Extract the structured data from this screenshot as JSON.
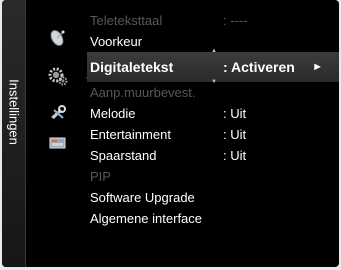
{
  "sidebar": {
    "title": "Instellingen"
  },
  "icons": [
    "satellite-dish-icon",
    "settings-gears-icon",
    "wrench-tools-icon",
    "input-source-icon"
  ],
  "menu": {
    "items": [
      {
        "label": "Teleteksttaal",
        "value": ": ----",
        "state": "disabled"
      },
      {
        "label": "Voorkeur",
        "value": "",
        "state": "normal"
      },
      {
        "label": "Digitaletekst",
        "value": ": Activeren",
        "state": "selected",
        "arrow": "►"
      },
      {
        "label": "Aanp.muurbevest.",
        "value": "",
        "state": "disabled"
      },
      {
        "label": "Melodie",
        "value": ": Uit",
        "state": "normal"
      },
      {
        "label": "Entertainment",
        "value": ": Uit",
        "state": "normal"
      },
      {
        "label": "Spaarstand",
        "value": ": Uit",
        "state": "normal"
      },
      {
        "label": "PIP",
        "value": "",
        "state": "disabled"
      },
      {
        "label": "Software Upgrade",
        "value": "",
        "state": "normal"
      },
      {
        "label": "Algemene interface",
        "value": "",
        "state": "normal"
      }
    ]
  }
}
